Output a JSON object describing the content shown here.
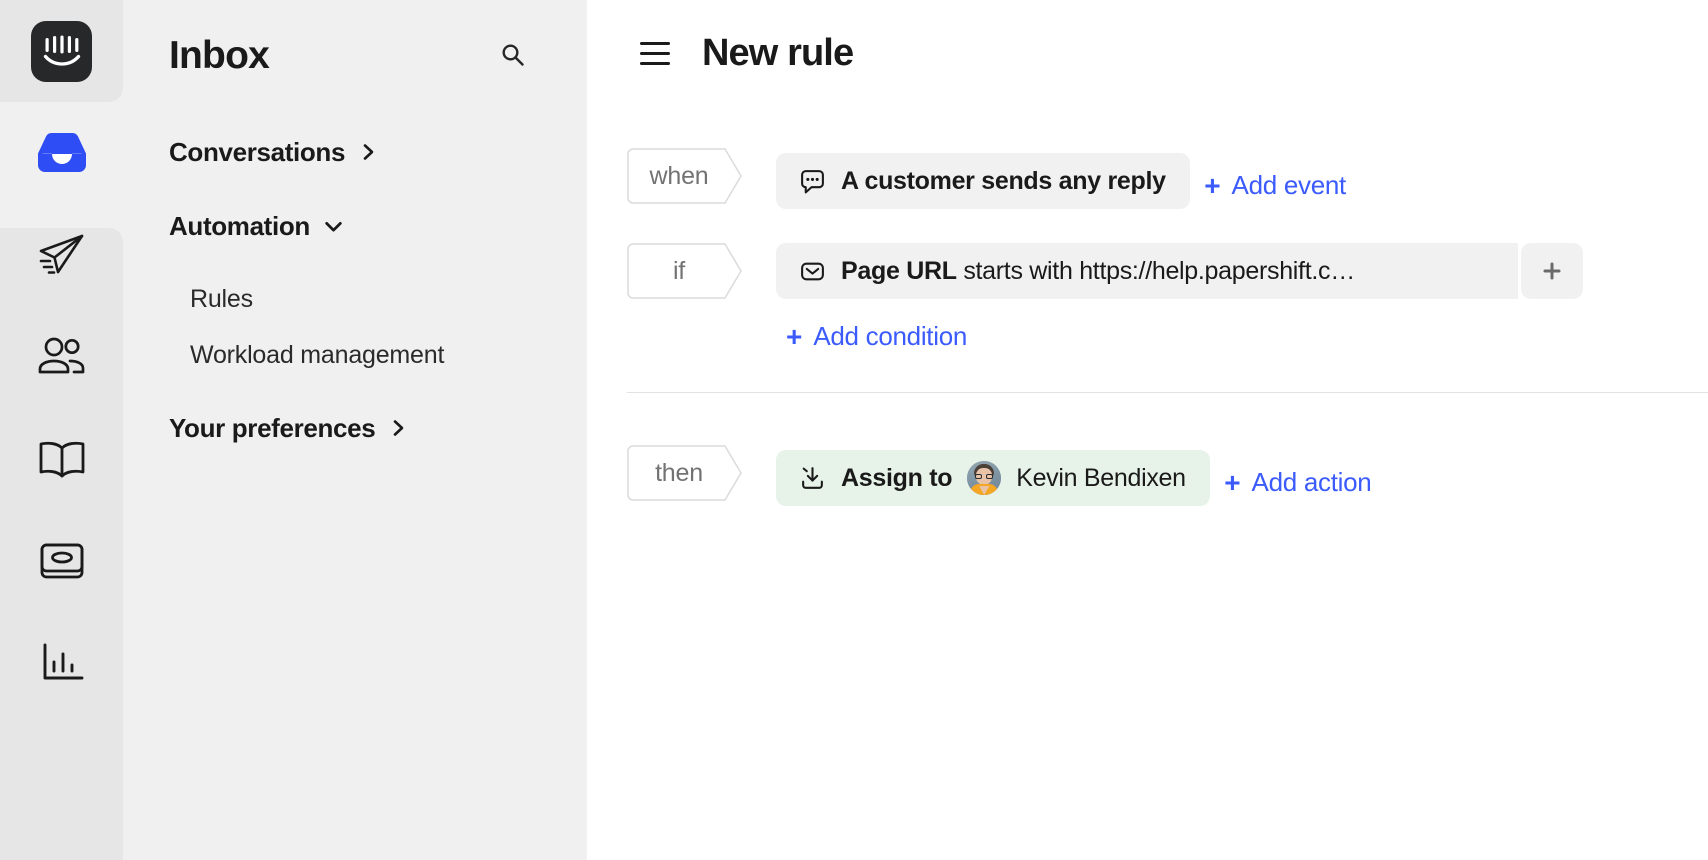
{
  "rail": {
    "logo": {
      "name": "intercom-logo",
      "alt": "Intercom"
    },
    "items": [
      {
        "icon": "inbox-icon",
        "label": "Inbox",
        "active": true
      },
      {
        "icon": "paper-plane-icon",
        "label": "Outbound"
      },
      {
        "icon": "people-icon",
        "label": "Contacts"
      },
      {
        "icon": "book-icon",
        "label": "Articles"
      },
      {
        "icon": "messenger-card-icon",
        "label": "Messenger"
      },
      {
        "icon": "bar-chart-icon",
        "label": "Reports"
      }
    ]
  },
  "sidebar": {
    "title": "Inbox",
    "search_icon": "search-icon",
    "items": [
      {
        "label": "Conversations",
        "type": "group",
        "chevron": "chevron-right-icon"
      },
      {
        "label": "Automation",
        "type": "group",
        "chevron": "chevron-down-icon"
      },
      {
        "label": "Rules",
        "type": "sub"
      },
      {
        "label": "Workload management",
        "type": "sub"
      },
      {
        "label": "Your preferences",
        "type": "group",
        "chevron": "chevron-right-icon"
      }
    ]
  },
  "main": {
    "menu_icon": "hamburger-icon",
    "title": "New rule",
    "sections": [
      {
        "tag": "when",
        "chip": {
          "icon": "speech-bubble-icon",
          "bold_text": "A customer sends any reply",
          "rest_text": "",
          "style": "grey",
          "has_plus": false
        },
        "add_label": "Add event",
        "add_icon": "plus-icon"
      },
      {
        "tag": "if",
        "chip": {
          "icon": "envelope-icon",
          "bold_text": "Page URL",
          "rest_text": " starts with https://help.papershift.c…",
          "style": "grey",
          "has_plus": true,
          "plus_icon": "plus-icon"
        },
        "add_label": "Add condition",
        "add_icon": "plus-icon"
      },
      {
        "tag": "then",
        "chip": {
          "icon": "assign-inbox-arrow-icon",
          "bold_text": "Assign to",
          "rest_text": "Kevin Bendixen",
          "avatar": "kevin-bendixen-avatar",
          "style": "green",
          "has_plus": false
        },
        "add_label": "Add action",
        "add_icon": "plus-icon"
      }
    ]
  },
  "colors": {
    "accent_blue": "#3b5bfd",
    "rail_bg": "#e6e6e6",
    "panel_bg": "#f0f0f0",
    "chip_grey": "#f1f1f1",
    "chip_green": "#e7f3e8",
    "text_dark": "#1a1a1a",
    "text_muted": "#737373"
  }
}
